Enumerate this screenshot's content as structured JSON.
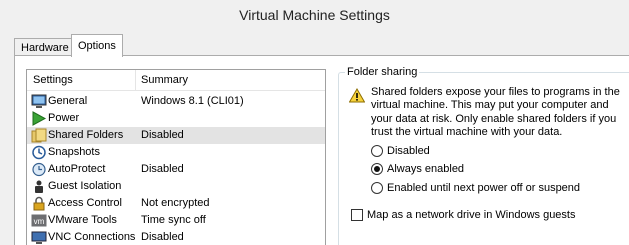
{
  "window": {
    "title": "Virtual Machine Settings"
  },
  "tabs": [
    {
      "label": "Hardware",
      "active": false
    },
    {
      "label": "Options",
      "active": true
    }
  ],
  "settings_list": {
    "headers": {
      "settings": "Settings",
      "summary": "Summary"
    },
    "rows": [
      {
        "name": "General",
        "summary": "Windows 8.1 (CLI01)",
        "icon": "monitor-icon"
      },
      {
        "name": "Power",
        "summary": "",
        "icon": "play-icon"
      },
      {
        "name": "Shared Folders",
        "summary": "Disabled",
        "icon": "folder-icon",
        "selected": true
      },
      {
        "name": "Snapshots",
        "summary": "",
        "icon": "snapshot-icon"
      },
      {
        "name": "AutoProtect",
        "summary": "Disabled",
        "icon": "clock-icon"
      },
      {
        "name": "Guest Isolation",
        "summary": "",
        "icon": "isolation-icon"
      },
      {
        "name": "Access Control",
        "summary": "Not encrypted",
        "icon": "lock-icon"
      },
      {
        "name": "VMware Tools",
        "summary": "Time sync off",
        "icon": "vm-icon"
      },
      {
        "name": "VNC Connections",
        "summary": "Disabled",
        "icon": "vnc-icon"
      }
    ]
  },
  "folder_sharing": {
    "group_label": "Folder sharing",
    "warning_text": "Shared folders expose your files to programs in the virtual machine. This may put your computer and your data at risk. Only enable shared folders if you trust the virtual machine with your data.",
    "options": [
      {
        "label": "Disabled",
        "selected": false
      },
      {
        "label": "Always enabled",
        "selected": true
      },
      {
        "label": "Enabled until next power off or suspend",
        "selected": false
      }
    ],
    "map_drive_label": "Map as a network drive in Windows guests",
    "map_drive_checked": false
  }
}
